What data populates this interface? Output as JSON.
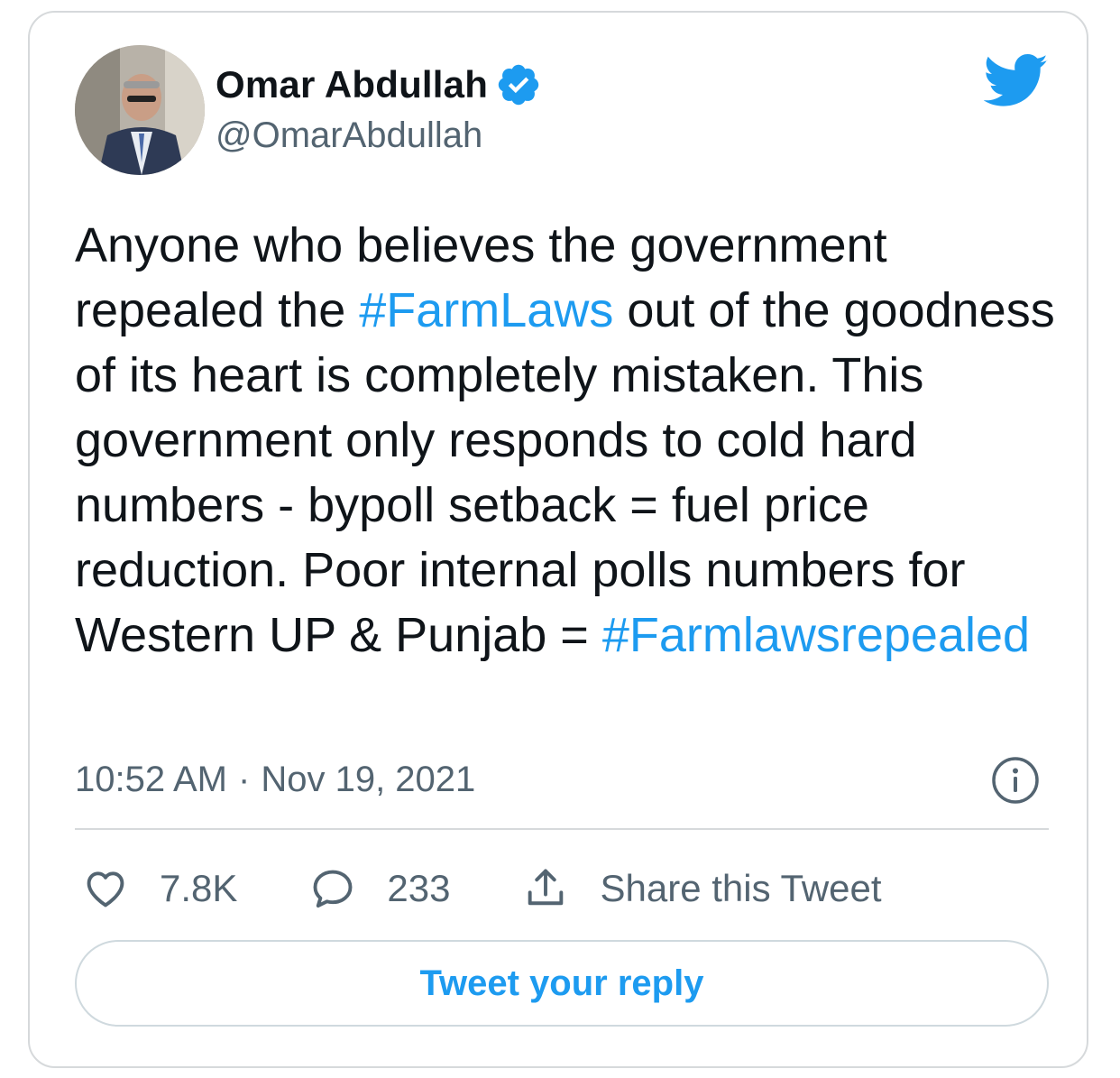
{
  "author": {
    "name": "Omar Abdullah",
    "handle": "@OmarAbdullah",
    "verified": true
  },
  "tweet": {
    "segments": [
      {
        "text": "Anyone who believes the government repealed the ",
        "type": "text"
      },
      {
        "text": "#FarmLaws",
        "type": "hashtag"
      },
      {
        "text": " out of the goodness of its heart is completely mistaken. This government only responds to cold hard numbers - bypoll setback = fuel price reduction. Poor internal polls numbers for Western UP & Punjab = ",
        "type": "text"
      },
      {
        "text": "#Farmlawsrepealed",
        "type": "hashtag"
      }
    ]
  },
  "meta": {
    "time": "10:52 AM",
    "separator": "·",
    "date": "Nov 19, 2021"
  },
  "actions": {
    "likes": "7.8K",
    "replies": "233",
    "share_label": "Share this Tweet"
  },
  "reply_button_label": "Tweet your reply",
  "icons": {
    "brand": "twitter-bird-icon",
    "verified": "verified-badge-icon",
    "info": "info-icon",
    "like": "heart-icon",
    "reply": "speech-bubble-icon",
    "share": "share-upload-icon"
  },
  "colors": {
    "accent": "#1d9bf0",
    "text": "#0f1419",
    "secondary_text": "#536471",
    "border": "#d6d9db"
  }
}
